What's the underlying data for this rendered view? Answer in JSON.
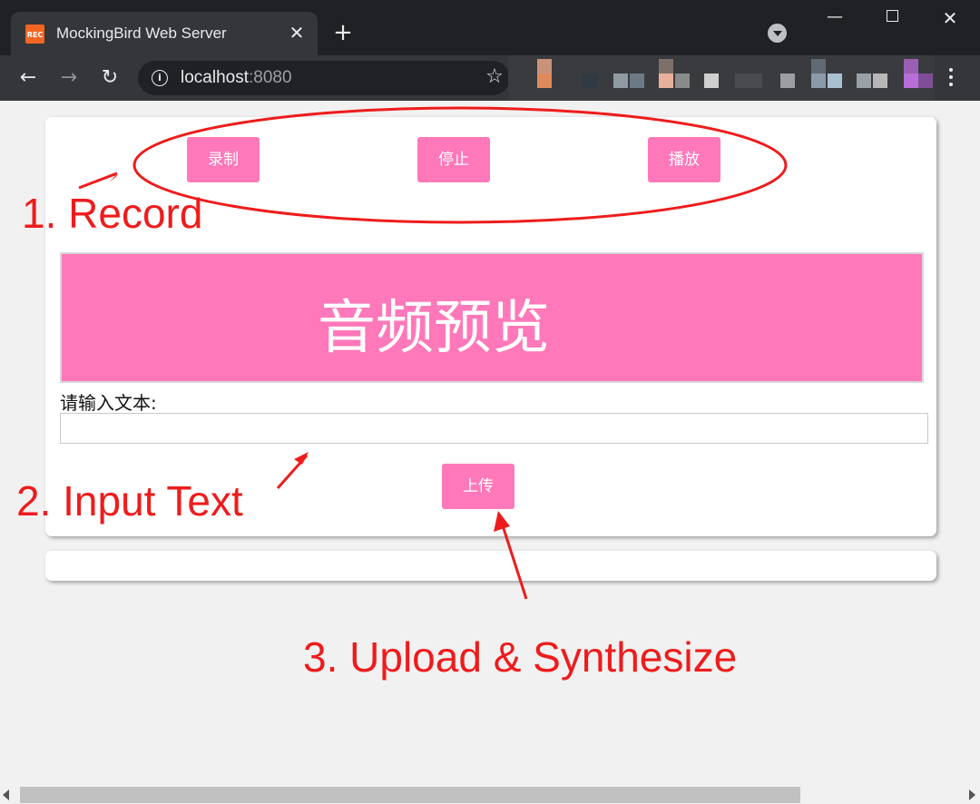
{
  "browser": {
    "tab_icon_text": "REC",
    "tab_title": "MockingBird Web Server",
    "close_tab_glyph": "✕",
    "new_tab_glyph": "+",
    "url_host": "localhost",
    "url_port": ":8080",
    "window_controls": [
      "minimize",
      "maximize",
      "close"
    ],
    "minimize_glyph": "—",
    "close_glyph": "✕",
    "back_glyph": "←",
    "forward_glyph": "→",
    "reload_glyph": "↻",
    "info_glyph": "i",
    "star_glyph": "☆"
  },
  "colors": {
    "accent_pink": "#ff78b9",
    "annotation_red": "#ee1c1c",
    "chrome_dark": "#202124",
    "chrome_toolbar": "#35363a",
    "page_bg": "#f1f1f1"
  },
  "controls": {
    "record_label": "录制",
    "stop_label": "停止",
    "play_label": "播放"
  },
  "preview": {
    "label": "音频预览"
  },
  "text_input": {
    "label": "请输入文本:",
    "value": ""
  },
  "upload": {
    "label": "上传"
  },
  "annotations": {
    "record": "1. Record",
    "input": "2. Input Text",
    "upload": "3. Upload & Synthesize"
  }
}
